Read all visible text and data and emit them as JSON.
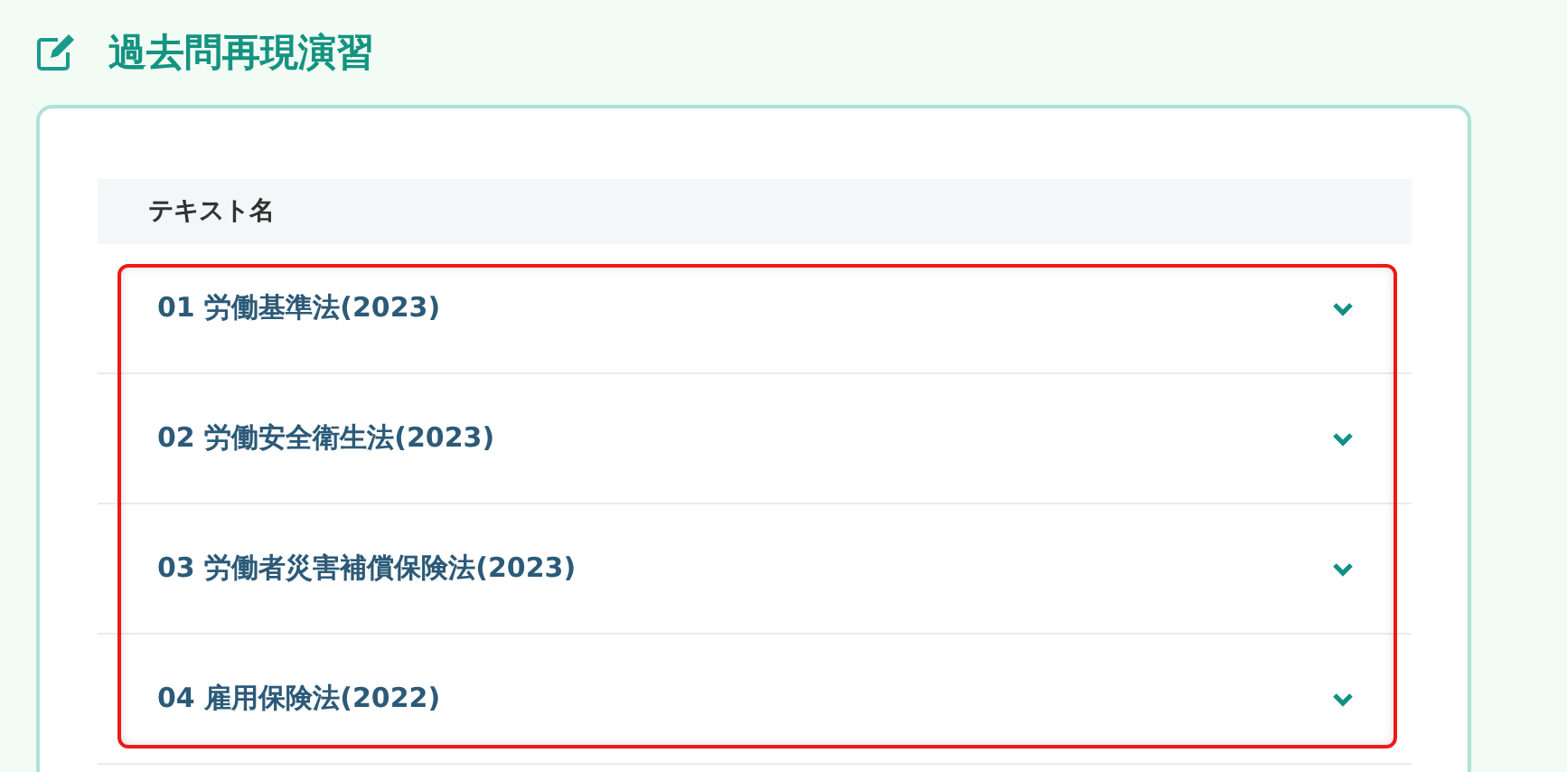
{
  "page": {
    "title": "過去問再現演習"
  },
  "table": {
    "columns": [
      "テキスト名"
    ],
    "rows": [
      {
        "label": "01 労働基準法(2023)",
        "expanded": false
      },
      {
        "label": "02 労働安全衛生法(2023)",
        "expanded": false
      },
      {
        "label": "03 労働者災害補償保険法(2023)",
        "expanded": false
      },
      {
        "label": "04 雇用保険法(2022)",
        "expanded": false
      }
    ]
  }
}
